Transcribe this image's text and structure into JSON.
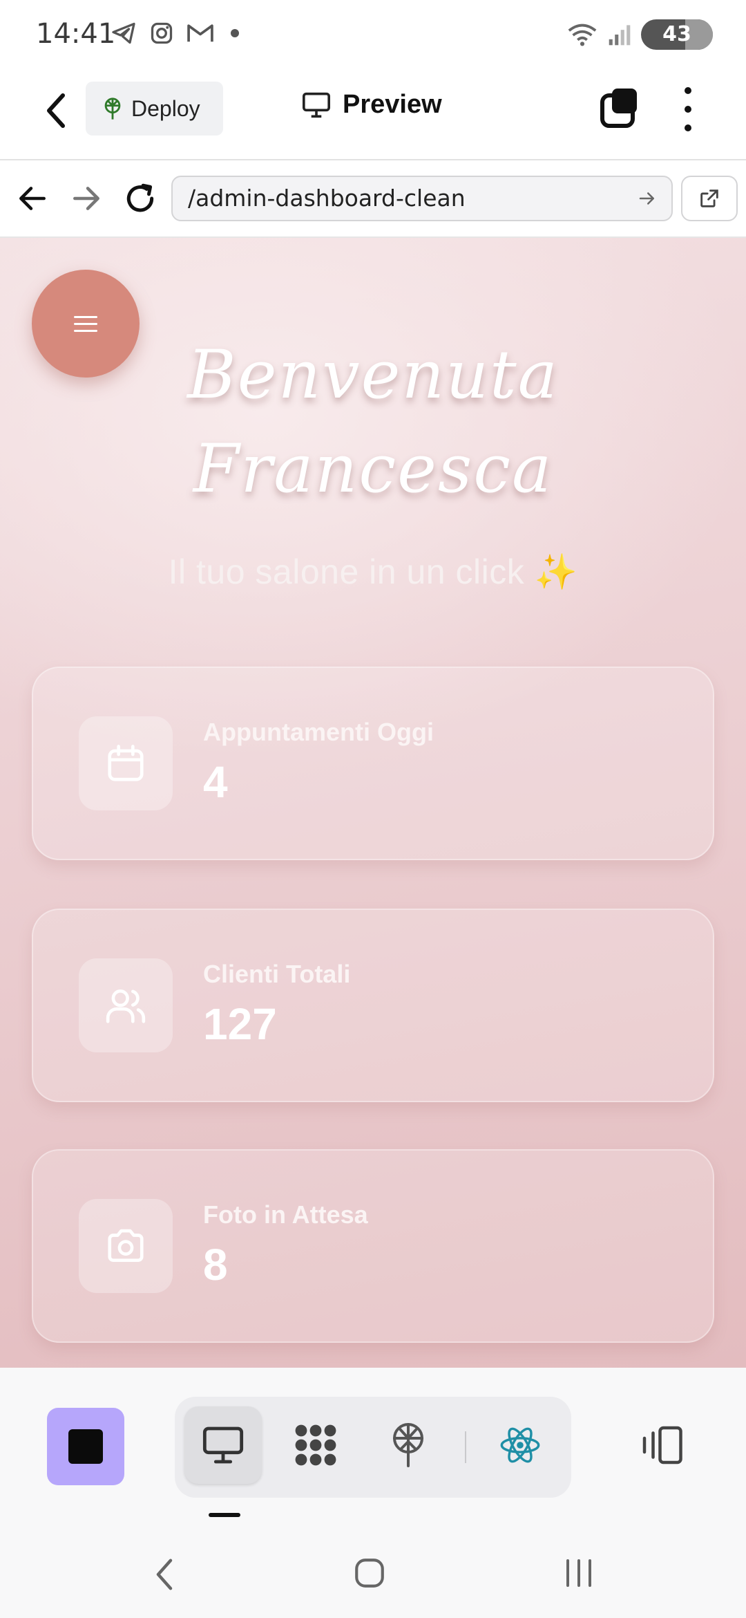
{
  "status_bar": {
    "time": "14:41",
    "icons": [
      "telegram-icon",
      "instagram-icon",
      "gmail-icon",
      "wifi-icon",
      "signal-icon"
    ],
    "battery": "43"
  },
  "header": {
    "deploy_label": "Deploy",
    "title": "Preview"
  },
  "url_bar": {
    "url": "/admin-dashboard-clean"
  },
  "dashboard": {
    "greeting_line1": "Benvenuta",
    "greeting_line2": "Francesca",
    "subtitle": "Il tuo salone in un click ✨",
    "stats": [
      {
        "label": "Appuntamenti Oggi",
        "value": "4",
        "icon": "calendar-icon"
      },
      {
        "label": "Clienti Totali",
        "value": "127",
        "icon": "users-icon"
      },
      {
        "label": "Foto in Attesa",
        "value": "8",
        "icon": "camera-icon"
      }
    ]
  },
  "toolbar": {
    "tools": [
      "desktop-preview",
      "apps-grid",
      "deploy",
      "react"
    ],
    "active_tool": "desktop-preview"
  },
  "colors": {
    "accent_fab": "#d6897c",
    "stop_button": "#b6a6fb",
    "react": "#1f8fa6"
  }
}
